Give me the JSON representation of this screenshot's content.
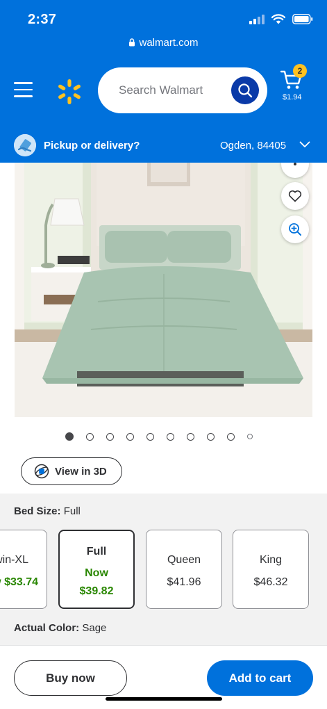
{
  "status_bar": {
    "time": "2:37"
  },
  "browser": {
    "url": "walmart.com"
  },
  "header": {
    "search_placeholder": "Search Walmart",
    "cart_count": "2",
    "cart_total": "$1.94"
  },
  "pickup": {
    "label": "Pickup or delivery?",
    "location": "Ogden, 84405"
  },
  "gallery": {
    "image_count": 10,
    "active_index": 0
  },
  "view3d": {
    "label": "View in 3D"
  },
  "variants": {
    "bed_size_label": "Bed Size:",
    "bed_size_value": "Full",
    "options": [
      {
        "name": "win-XL",
        "price": "w $33.74"
      },
      {
        "name": "Full",
        "now_label": "Now",
        "price": "$39.82"
      },
      {
        "name": "Queen",
        "price": "$41.96"
      },
      {
        "name": "King",
        "price": "$46.32"
      }
    ],
    "color_label": "Actual Color:",
    "color_value": "Sage"
  },
  "actions": {
    "buy_now": "Buy now",
    "add_to_cart": "Add to cart"
  },
  "colors": {
    "walmart_blue": "#0071dc",
    "spark_yellow": "#ffc220",
    "price_green": "#2a8703",
    "search_button_blue": "#0a3aa8"
  }
}
